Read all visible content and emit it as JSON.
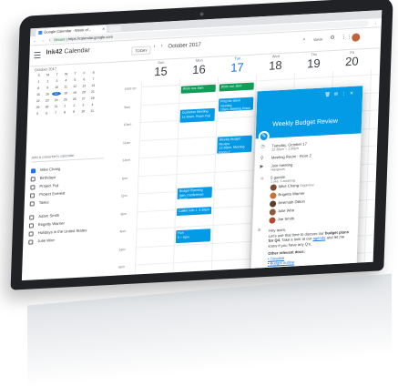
{
  "browser": {
    "tab_title": "Google Calendar - Week of...",
    "secure_label": "Secure",
    "url": "https://calendar.google.com",
    "nav_buttons": "← → C"
  },
  "header": {
    "brand": "Ink42",
    "brand_suffix": "Calendar",
    "today_label": "TODAY",
    "prev": "‹",
    "next": "›",
    "month": "October 2017",
    "view_label": "Week",
    "search_icon": "search-icon",
    "settings_icon": "gear-icon",
    "apps_icon": "apps-icon"
  },
  "sidebar": {
    "mini_month": "October 2017",
    "weekday_initials": [
      "S",
      "M",
      "T",
      "W",
      "T",
      "F",
      "S"
    ],
    "weeks": [
      [
        "1",
        "2",
        "3",
        "4",
        "5",
        "6",
        "7"
      ],
      [
        "8",
        "9",
        "10",
        "11",
        "12",
        "13",
        "14"
      ],
      [
        "15",
        "16",
        "17",
        "18",
        "19",
        "20",
        "21"
      ],
      [
        "22",
        "23",
        "24",
        "25",
        "26",
        "27",
        "28"
      ],
      [
        "29",
        "30",
        "31",
        "1",
        "2",
        "3",
        "4"
      ],
      [
        "5",
        "6",
        "7",
        "8",
        "9",
        "10",
        "11"
      ]
    ],
    "selected_day": "17",
    "add_calendar_placeholder": "Add a coworker's calendar",
    "my_calendars": [
      {
        "label": "Mike Chang",
        "checked": true
      },
      {
        "label": "Birthdays",
        "checked": false
      },
      {
        "label": "Project Fuji",
        "checked": false
      },
      {
        "label": "Project Everest",
        "checked": false
      },
      {
        "label": "Tasks",
        "checked": false
      }
    ],
    "other_calendars": [
      {
        "label": "Adam Smith",
        "checked": false
      },
      {
        "label": "Brigetty Warner",
        "checked": false
      },
      {
        "label": "Holidays in the United States",
        "checked": false
      },
      {
        "label": "Julie Wire",
        "checked": false
      }
    ]
  },
  "week": {
    "days": [
      {
        "name": "Sun",
        "date": "15"
      },
      {
        "name": "Mon",
        "date": "16"
      },
      {
        "name": "Tue",
        "date": "17"
      },
      {
        "name": "Wed",
        "date": "18"
      },
      {
        "name": "Thu",
        "date": "19"
      },
      {
        "name": "Fri",
        "date": "20"
      },
      {
        "name": "Sat",
        "date": "21"
      }
    ],
    "current_day_index": 2,
    "time_labels": [
      "GMT-07",
      "9am",
      "10am",
      "11am",
      "12pm",
      "1pm",
      "2pm",
      "3pm",
      "4pm",
      "5pm",
      "6pm",
      "7pm",
      "8pm",
      "9pm"
    ],
    "events": [
      {
        "day": 1,
        "title": "Work out, 8am",
        "color": "green"
      },
      {
        "day": 2,
        "title": "Work out, 8am",
        "color": "green"
      },
      {
        "day": 2,
        "title": "Prep for client meeting",
        "subtitle": "10am, Meeting Room 1",
        "color": "blue"
      },
      {
        "day": 1,
        "title": "Customer Meeting",
        "subtitle": "11:30am, Room Fuji",
        "color": "blue"
      },
      {
        "day": 2,
        "title": "Weekly Budget Review",
        "subtitle": "12:30pm, Meeting Room 2",
        "color": "blue"
      },
      {
        "day": 1,
        "title": "Budget Planning",
        "subtitle": "3pm, Conference Room",
        "color": "blue"
      },
      {
        "day": 1,
        "title": "Coffee with J, 3:30pm",
        "color": "blue"
      },
      {
        "day": 1,
        "title": "Run",
        "subtitle": "5 – 6pm",
        "color": "blue"
      }
    ]
  },
  "popup": {
    "title": "Weekly Budget Review",
    "date": "Tuesday, October 17",
    "time": "12:30pm – 1:30pm",
    "location": "Meeting Room - Floor 2",
    "hangout": "Join meeting",
    "hangout_sub": "Hangouts",
    "guests_count": "5 guests",
    "guests_sub": "1 yes, 1 awaiting",
    "guests": [
      {
        "name": "Mike Chang",
        "role": "Organizer",
        "color": "#7b4a2f"
      },
      {
        "name": "Brigetta Warner",
        "role": "",
        "color": "#c4723c"
      },
      {
        "name": "Jeremiah Dillion",
        "role": "",
        "color": "#5a3e2b"
      },
      {
        "name": "Julie Wire",
        "role": "",
        "color": "#8d5b3a"
      },
      {
        "name": "Joe Smith",
        "role": "",
        "color": "#b14b2f"
      }
    ],
    "note_greeting": "Hey team,",
    "note_line1": "Let's use that time to discuss our",
    "note_bold": "budget plans for Q4.",
    "note_line2": "Take a look at our",
    "note_link": "agenda",
    "note_line3": "and let me know if you have any Q's.",
    "other_title": "Other relevant docs:",
    "docs": [
      "Timeline",
      "Budget outline"
    ]
  },
  "fab_label": "+"
}
